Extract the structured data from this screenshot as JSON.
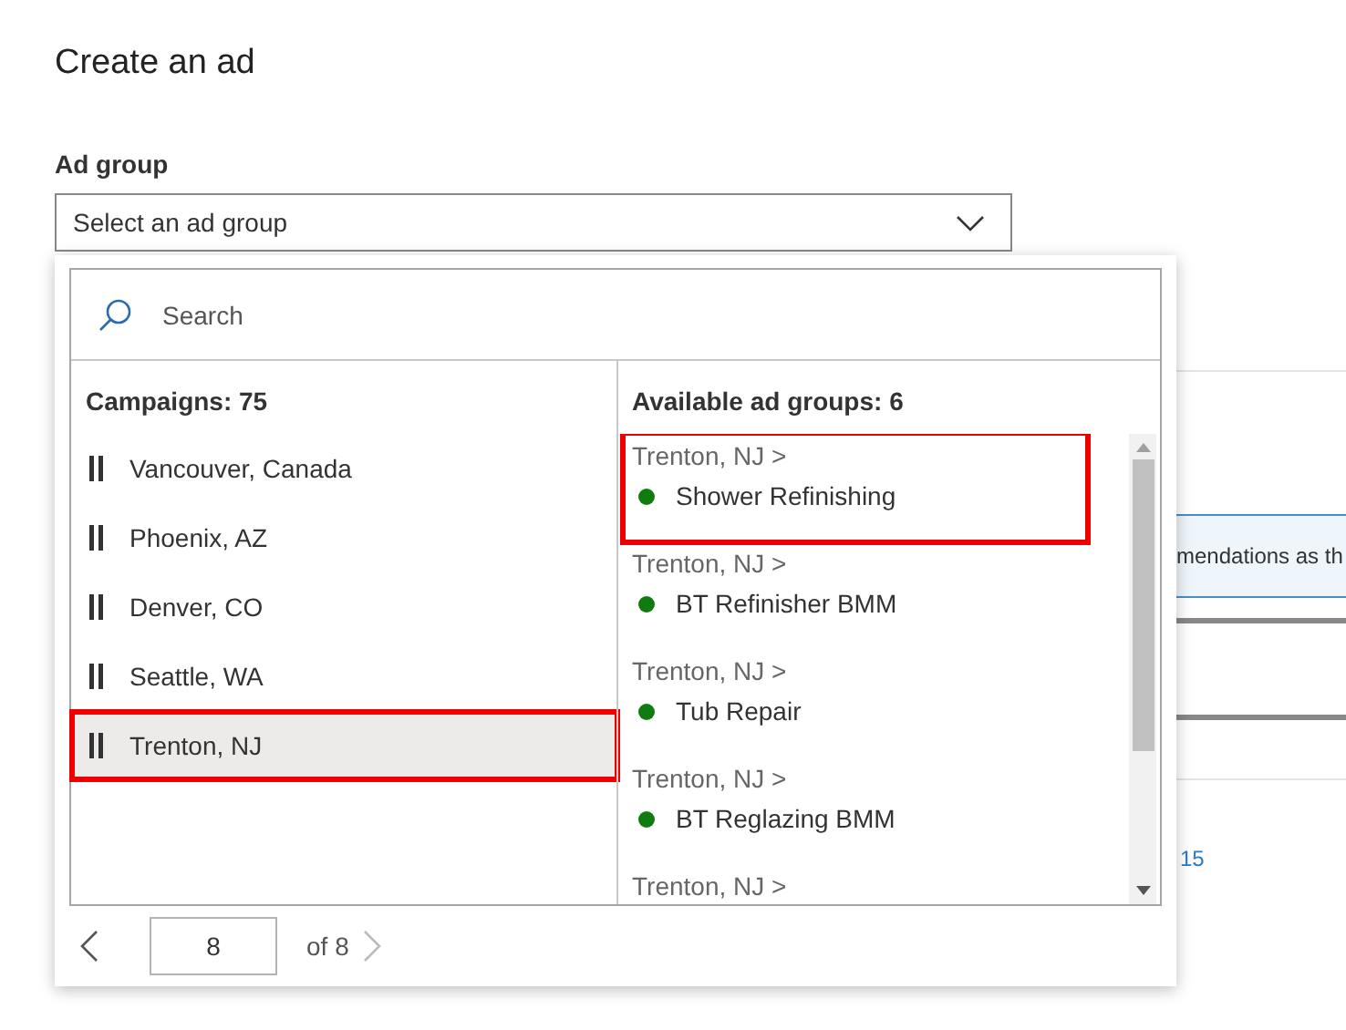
{
  "page": {
    "title": "Create an ad"
  },
  "ad_group_field": {
    "label": "Ad group",
    "placeholder": "Select an ad group"
  },
  "background": {
    "banner_text": "mendations as th",
    "link_text": "15"
  },
  "picker": {
    "search": {
      "placeholder": "Search"
    },
    "campaigns_header": "Campaigns: 75",
    "campaigns": [
      {
        "name": "Vancouver, Canada",
        "selected": false
      },
      {
        "name": "Phoenix, AZ",
        "selected": false
      },
      {
        "name": "Denver, CO",
        "selected": false
      },
      {
        "name": "Seattle, WA",
        "selected": false
      },
      {
        "name": "Trenton, NJ",
        "selected": true
      }
    ],
    "ad_groups_header": "Available ad groups: 6",
    "ad_groups": [
      {
        "path": "Trenton, NJ >",
        "name": "Shower Refinishing",
        "selected": true
      },
      {
        "path": "Trenton, NJ >",
        "name": "BT Refinisher BMM",
        "selected": false
      },
      {
        "path": "Trenton, NJ >",
        "name": "Tub Repair",
        "selected": false
      },
      {
        "path": "Trenton, NJ >",
        "name": "BT Reglazing BMM",
        "selected": false
      },
      {
        "path": "Trenton, NJ >"
      }
    ],
    "pager": {
      "page": "8",
      "of": "of 8"
    }
  }
}
